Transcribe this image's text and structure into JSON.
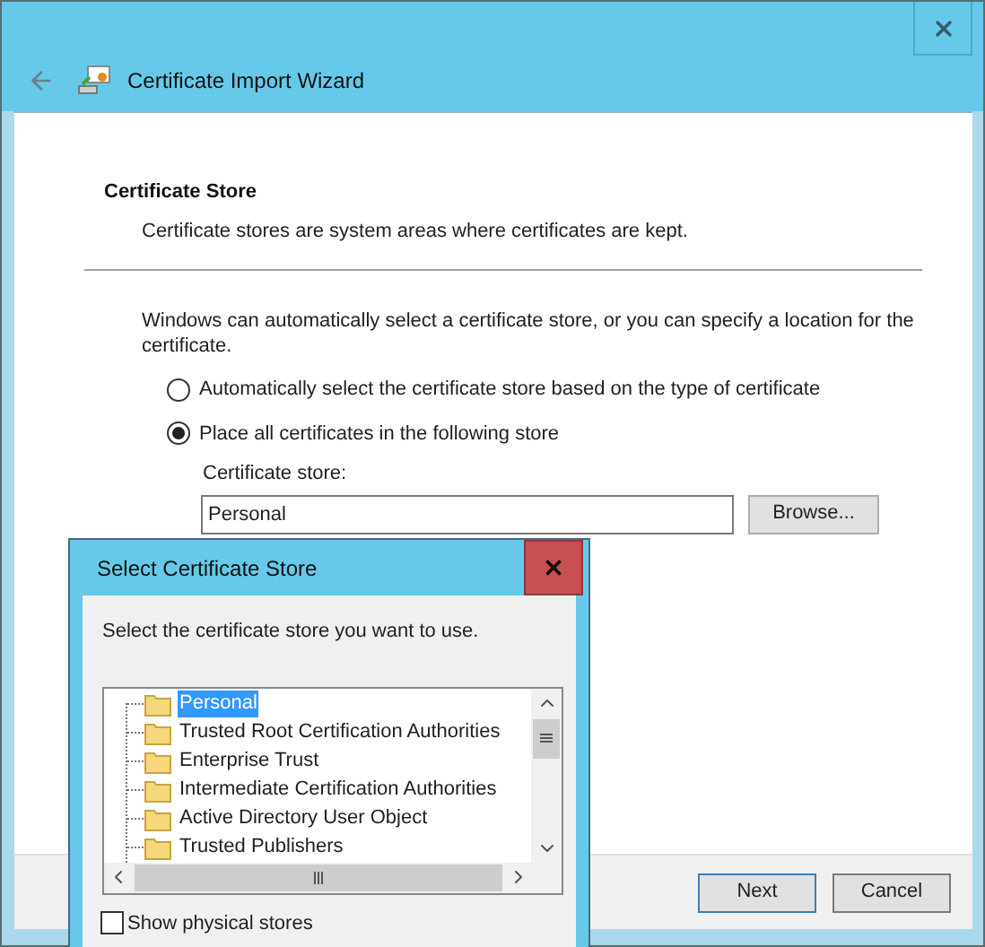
{
  "window": {
    "title": "Certificate Import Wizard"
  },
  "page": {
    "heading": "Certificate Store",
    "description": "Certificate stores are system areas where certificates are kept.",
    "instruction": "Windows can automatically select a certificate store, or you can specify a location for the certificate.",
    "options": [
      {
        "label": "Automatically select the certificate store based on the type of certificate",
        "selected": false
      },
      {
        "label": "Place all certificates in the following store",
        "selected": true
      }
    ],
    "store_field": {
      "label": "Certificate store:",
      "value": "Personal"
    },
    "browse_button": "Browse..."
  },
  "buttons": [
    {
      "label": "Next",
      "default": true
    },
    {
      "label": "Cancel",
      "default": false
    }
  ],
  "dialog": {
    "title": "Select Certificate Store",
    "prompt": "Select the certificate store you want to use.",
    "stores": [
      {
        "label": "Personal",
        "selected": true
      },
      {
        "label": "Trusted Root Certification Authorities",
        "selected": false
      },
      {
        "label": "Enterprise Trust",
        "selected": false
      },
      {
        "label": "Intermediate Certification Authorities",
        "selected": false
      },
      {
        "label": "Active Directory User Object",
        "selected": false
      },
      {
        "label": "Trusted Publishers",
        "selected": false
      }
    ],
    "show_physical": {
      "label": "Show physical stores",
      "checked": false
    }
  }
}
